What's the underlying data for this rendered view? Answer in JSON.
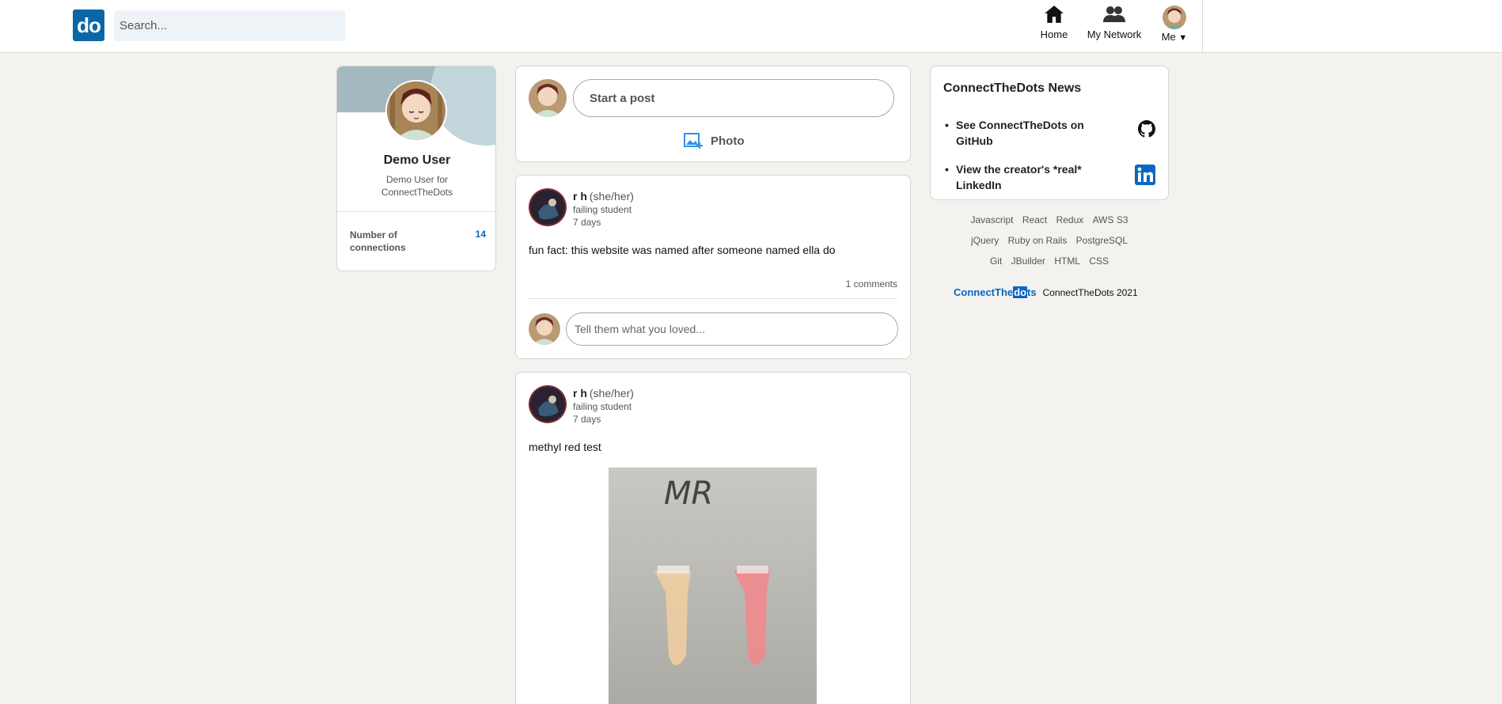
{
  "nav": {
    "logo": "do",
    "search_placeholder": "Search...",
    "home_label": "Home",
    "network_label": "My Network",
    "me_label": "Me"
  },
  "profile": {
    "name": "Demo User",
    "subtitle": "Demo User for ConnectTheDots",
    "connections_label": "Number of connections",
    "connections_count": "14"
  },
  "composer": {
    "start_label": "Start a post",
    "photo_label": "Photo"
  },
  "posts": [
    {
      "author": "r h",
      "pronouns": "(she/her)",
      "headline": "failing student",
      "time": "7 days",
      "body": "fun fact: this website was named after someone named ella do",
      "comments": "1 comments",
      "comment_placeholder": "Tell them what you loved..."
    },
    {
      "author": "r h",
      "pronouns": "(she/her)",
      "headline": "failing student",
      "time": "7 days",
      "body": "methyl red test",
      "image_text": "MR"
    }
  ],
  "news": {
    "title": "ConnectTheDots News",
    "items": [
      {
        "label": "See ConnectTheDots on GitHub",
        "icon": "github-icon"
      },
      {
        "label": "View the creator's *real* LinkedIn",
        "icon": "linkedin-icon"
      }
    ]
  },
  "footer": {
    "links_row1": [
      "Javascript",
      "React",
      "Redux",
      "AWS S3"
    ],
    "links_row2": [
      "jQuery",
      "Ruby on Rails",
      "PostgreSQL"
    ],
    "links_row3": [
      "Git",
      "JBuilder",
      "HTML",
      "CSS"
    ],
    "brand_pre": "ConnectThe",
    "brand_dot": "do",
    "brand_post": "ts",
    "copyright": "ConnectTheDots 2021"
  },
  "colors": {
    "brand": "#0a66c2",
    "background": "#f3f2ef"
  }
}
